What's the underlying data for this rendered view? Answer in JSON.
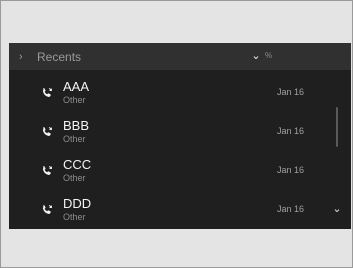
{
  "header": {
    "back_chevron": "›",
    "title": "Recents",
    "dropdown_icon": "⌄",
    "tiny": "%"
  },
  "items": [
    {
      "name": "AAA",
      "type": "Other",
      "date": "Jan 16",
      "icon": "phone-icon"
    },
    {
      "name": "BBB",
      "type": "Other",
      "date": "Jan 16",
      "icon": "phone-icon"
    },
    {
      "name": "CCC",
      "type": "Other",
      "date": "Jan 16",
      "icon": "phone-icon"
    },
    {
      "name": "DDD",
      "type": "Other",
      "date": "Jan 16",
      "icon": "phone-icon"
    }
  ],
  "scroll_down_icon": "⌄",
  "colors": {
    "screen_bg": "#1f1f1f",
    "header_bg": "#303030",
    "text_primary": "#f4f4f4",
    "text_secondary": "#8c8c8c"
  }
}
